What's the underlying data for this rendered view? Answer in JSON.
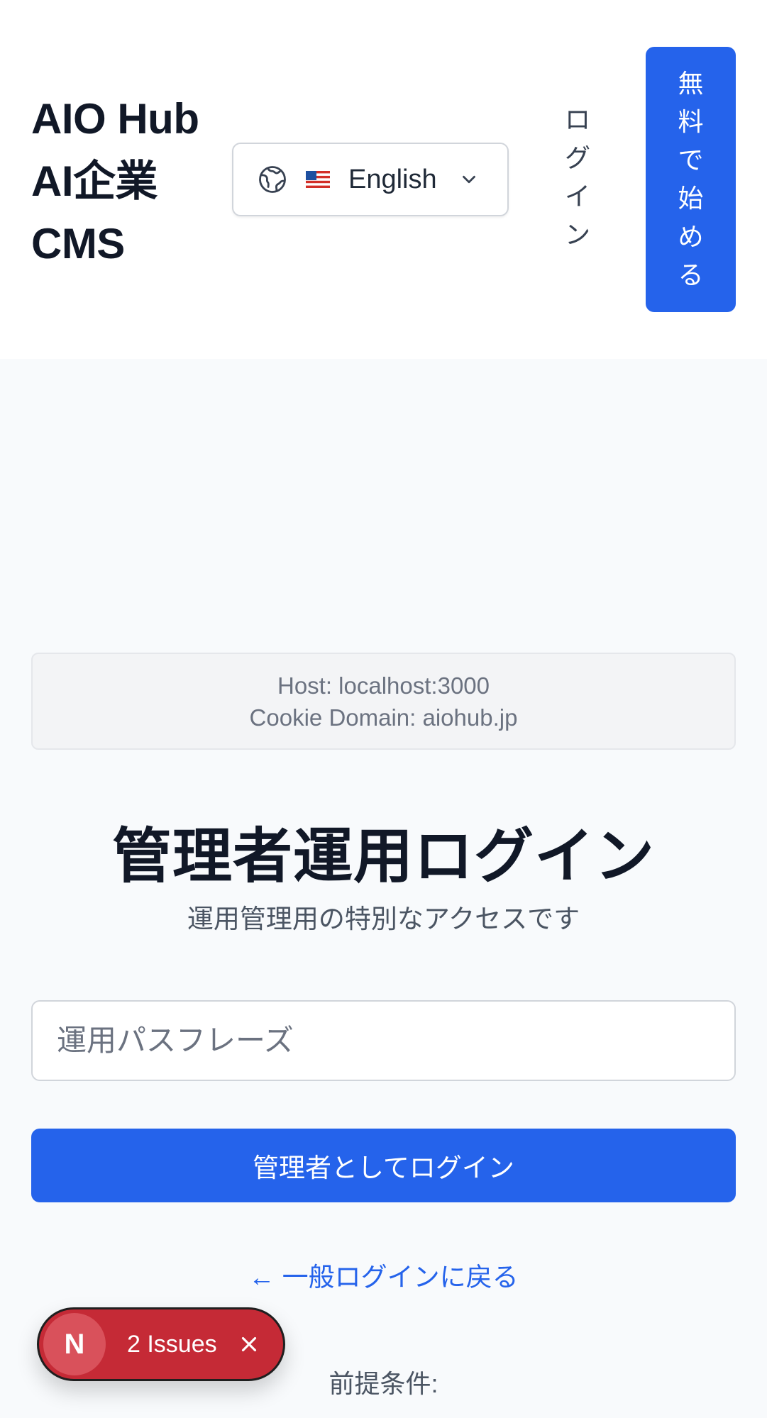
{
  "header": {
    "brand_line1": "AIO Hub",
    "brand_line2": "AI企業",
    "brand_line3": "CMS",
    "language": {
      "icon": "globe-icon",
      "flag": "us-flag-icon",
      "selected": "English"
    },
    "login_label": "ログイン",
    "cta_label": "無料で始める"
  },
  "debug": {
    "host": "Host: localhost:3000",
    "cookie_domain": "Cookie Domain: aiohub.jp"
  },
  "main": {
    "title": "管理者運用ログイン",
    "subtitle": "運用管理用の特別なアクセスです",
    "passphrase_placeholder": "運用パスフレーズ",
    "passphrase_value": "",
    "submit_label": "管理者としてログイン",
    "back_link": "← 一般ログインに戻る",
    "prereq_label": "前提条件:"
  },
  "dev_overlay": {
    "logo_letter": "N",
    "issues_label": "2 Issues",
    "close_icon": "close-icon"
  },
  "colors": {
    "primary": "#2563eb",
    "issues_red": "#c52a36",
    "background": "#f8fafc"
  }
}
